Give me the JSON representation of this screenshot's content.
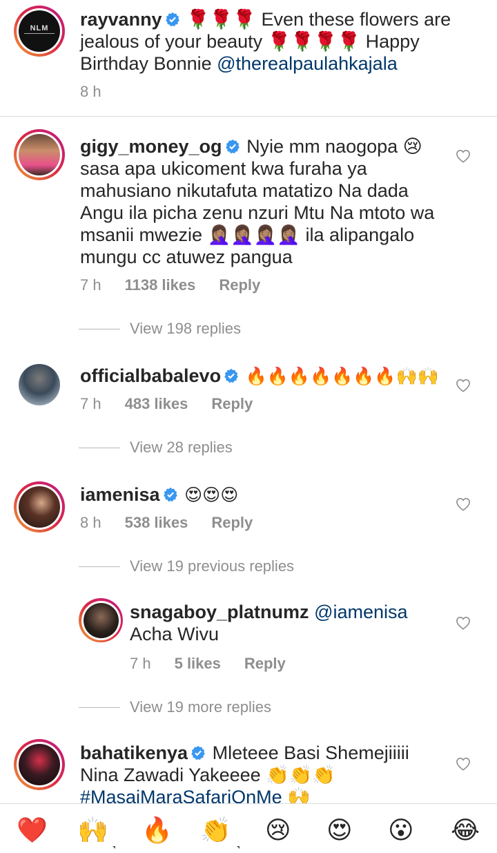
{
  "comments": [
    {
      "username": "rayvanny",
      "text_parts": [
        "🌹🌹🌹 Even these flowers are jealous of your beauty 🌹🌹🌹🌹 Happy Birthday Bonnie "
      ],
      "mention": "@therealpaulahkajala",
      "time": "8 h",
      "avatar_text": "NLM"
    },
    {
      "username": "gigy_money_og",
      "text": "Nyie mm naogopa 😢 sasa apa ukicoment kwa furaha ya mahusiano nikutafuta matatizo Na dada Angu ila picha zenu nzuri Mtu Na mtoto wa msanii mwezie 🤦🏽‍♀️🤦🏽‍♀️🤦🏽‍♀️🤦🏽‍♀️ ila alipangalo mungu cc atuwez pangua",
      "time": "7 h",
      "likes": "1138 likes",
      "reply": "Reply",
      "view_replies": "View 198 replies"
    },
    {
      "username": "officialbabalevo",
      "text": "🔥🔥🔥🔥🔥🔥🔥🙌🙌",
      "time": "7 h",
      "likes": "483 likes",
      "reply": "Reply",
      "view_replies": "View 28 replies"
    },
    {
      "username": "iamenisa",
      "text": "😍😍😍",
      "time": "8 h",
      "likes": "538 likes",
      "reply": "Reply",
      "view_previous": "View 19 previous replies",
      "view_more": "View 19 more replies"
    },
    {
      "username": "snagaboy_platnumz",
      "mention": "@iamenisa",
      "text": "Acha Wivu",
      "time": "7 h",
      "likes": "5 likes",
      "reply": "Reply"
    },
    {
      "username": "bahatikenya",
      "text": "Mleteee Basi Shemejiiiii Nina Zawadi Yakeeee 👏👏👏",
      "hashtag": "#MasaiMaraSafariOnMe",
      "hashtag_emoji": "🙌"
    }
  ],
  "reactions": [
    "❤️",
    "🙌",
    "🔥",
    "👏",
    "😢",
    "😍",
    "😮",
    "😂"
  ],
  "colors": {
    "verified": "#3897f0",
    "mention": "#00376b",
    "meta": "#8e8e8e"
  }
}
